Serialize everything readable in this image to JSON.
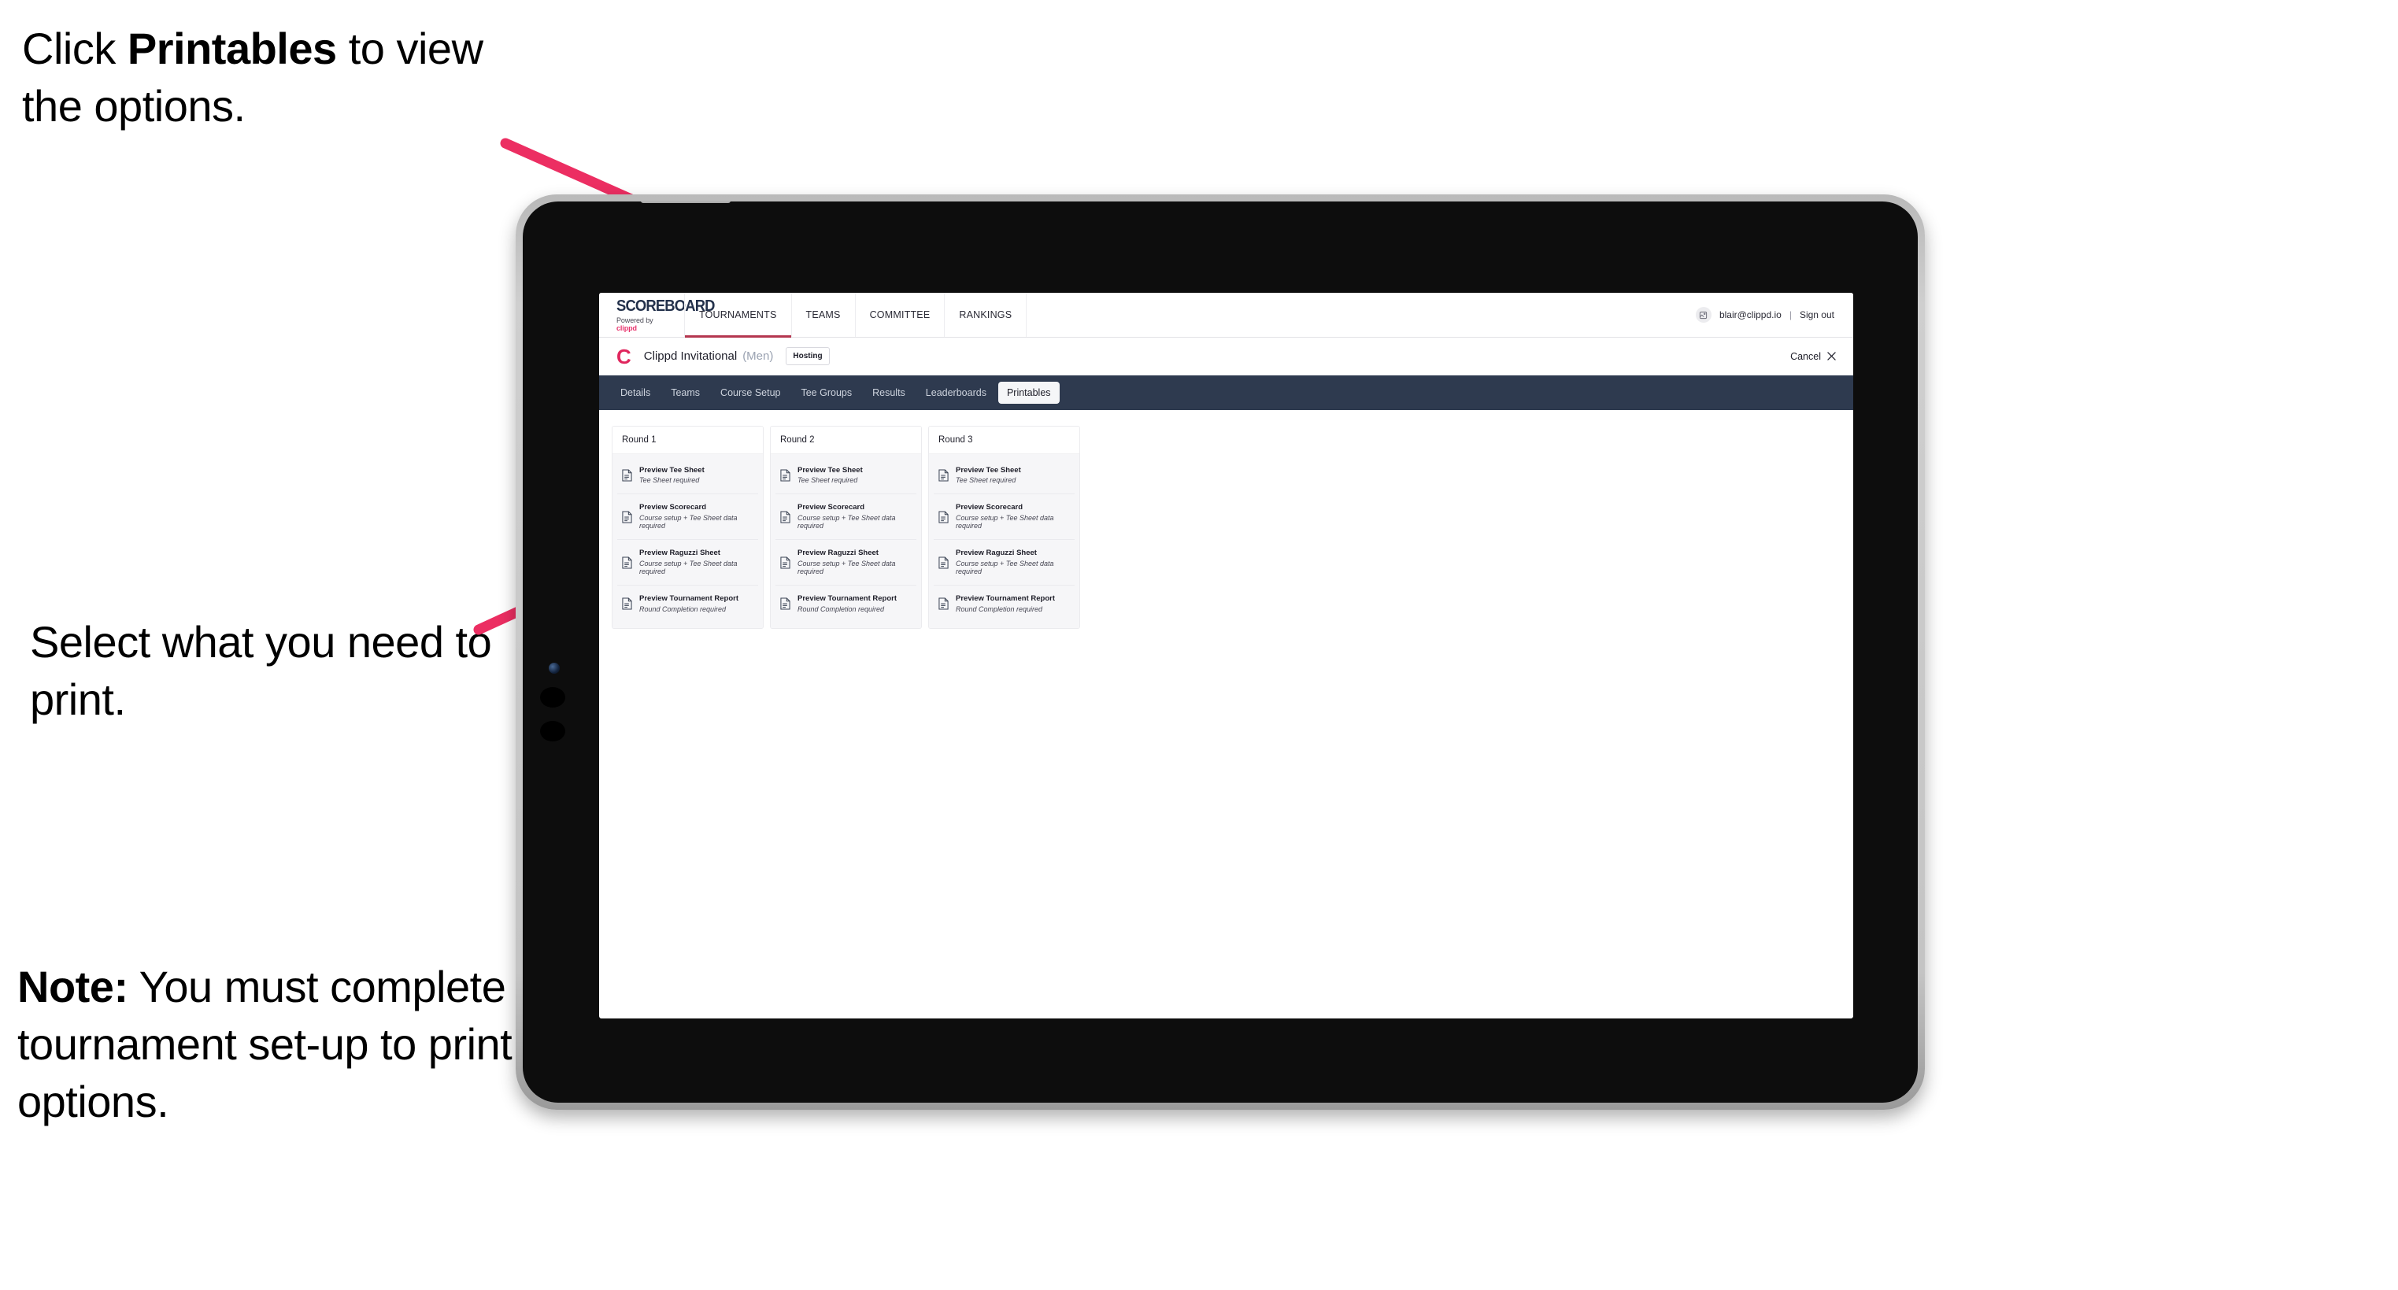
{
  "annotations": {
    "click_printables": {
      "pre": "Click ",
      "bold": "Printables",
      "post": " to view the options."
    },
    "select_print": "Select what you need to print.",
    "note": {
      "bold": "Note:",
      "text": " You must complete the tournament set-up to print all the options."
    }
  },
  "screen": {
    "brand": {
      "title": "SCOREBOARD",
      "powered_by": "Powered by ",
      "powered_brand": "clippd"
    },
    "main_nav": [
      {
        "label": "TOURNAMENTS",
        "active": true
      },
      {
        "label": "TEAMS",
        "active": false
      },
      {
        "label": "COMMITTEE",
        "active": false
      },
      {
        "label": "RANKINGS",
        "active": false
      }
    ],
    "user": {
      "avatar_icon": "user-avatar-icon",
      "email": "blair@clippd.io",
      "separator": "|",
      "sign_out": "Sign out"
    },
    "tournament_header": {
      "logo_letter": "C",
      "name": "Clippd Invitational",
      "gender": "(Men)",
      "status_badge": "Hosting",
      "cancel_label": "Cancel",
      "cancel_icon": "close-icon"
    },
    "sub_tabs": [
      {
        "label": "Details",
        "active": false
      },
      {
        "label": "Teams",
        "active": false
      },
      {
        "label": "Course Setup",
        "active": false
      },
      {
        "label": "Tee Groups",
        "active": false
      },
      {
        "label": "Results",
        "active": false
      },
      {
        "label": "Leaderboards",
        "active": false
      },
      {
        "label": "Printables",
        "active": true
      }
    ],
    "rounds": [
      {
        "heading": "Round 1",
        "items": [
          {
            "title": "Preview Tee Sheet",
            "subtitle": "Tee Sheet required",
            "icon": "document-icon"
          },
          {
            "title": "Preview Scorecard",
            "subtitle": "Course setup + Tee Sheet data required",
            "icon": "document-icon"
          },
          {
            "title": "Preview Raguzzi Sheet",
            "subtitle": "Course setup + Tee Sheet data required",
            "icon": "document-icon"
          },
          {
            "title": "Preview Tournament Report",
            "subtitle": "Round Completion required",
            "icon": "document-icon"
          }
        ]
      },
      {
        "heading": "Round 2",
        "items": [
          {
            "title": "Preview Tee Sheet",
            "subtitle": "Tee Sheet required",
            "icon": "document-icon"
          },
          {
            "title": "Preview Scorecard",
            "subtitle": "Course setup + Tee Sheet data required",
            "icon": "document-icon"
          },
          {
            "title": "Preview Raguzzi Sheet",
            "subtitle": "Course setup + Tee Sheet data required",
            "icon": "document-icon"
          },
          {
            "title": "Preview Tournament Report",
            "subtitle": "Round Completion required",
            "icon": "document-icon"
          }
        ]
      },
      {
        "heading": "Round 3",
        "items": [
          {
            "title": "Preview Tee Sheet",
            "subtitle": "Tee Sheet required",
            "icon": "document-icon"
          },
          {
            "title": "Preview Scorecard",
            "subtitle": "Course setup + Tee Sheet data required",
            "icon": "document-icon"
          },
          {
            "title": "Preview Raguzzi Sheet",
            "subtitle": "Course setup + Tee Sheet data required",
            "icon": "document-icon"
          },
          {
            "title": "Preview Tournament Report",
            "subtitle": "Round Completion required",
            "icon": "document-icon"
          }
        ]
      }
    ]
  },
  "colors": {
    "accent_pink": "#e8336d",
    "arrow_pink": "#ec2e62",
    "navbar_dark": "#2e3a4f",
    "brand_navy": "#23314b",
    "logo_pink": "#e0275e",
    "tab_underline": "#b4364f"
  }
}
